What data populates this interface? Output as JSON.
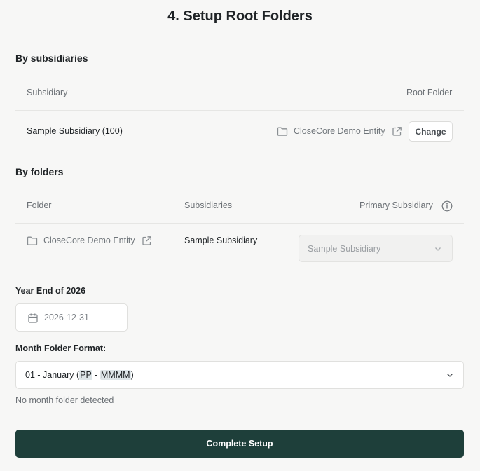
{
  "page": {
    "title": "4. Setup Root Folders"
  },
  "by_subsidiaries": {
    "heading": "By subsidiaries",
    "columns": {
      "subsidiary": "Subsidiary",
      "root_folder": "Root Folder"
    },
    "row": {
      "subsidiary": "Sample Subsidiary (100)",
      "folder_name": "CloseCore Demo Entity",
      "change_label": "Change"
    }
  },
  "by_folders": {
    "heading": "By folders",
    "columns": {
      "folder": "Folder",
      "subsidiaries": "Subsidiaries",
      "primary_subsidiary": "Primary Subsidiary"
    },
    "row": {
      "folder_name": "CloseCore Demo Entity",
      "subsidiaries": "Sample Subsidiary",
      "primary_subsidiary_value": "Sample Subsidiary"
    }
  },
  "year_end": {
    "label": "Year End of 2026",
    "value": "2026-12-31"
  },
  "month_format": {
    "label": "Month Folder Format:",
    "value_prefix": "01 - January (",
    "token_1": "PP",
    "separator": " - ",
    "token_2": "MMMM",
    "value_suffix": ")",
    "hint": "No month folder detected"
  },
  "complete_button": {
    "label": "Complete Setup"
  },
  "colors": {
    "primary": "#1e3f3a",
    "background": "#f7f7f6",
    "divider": "#e6e6e4"
  }
}
